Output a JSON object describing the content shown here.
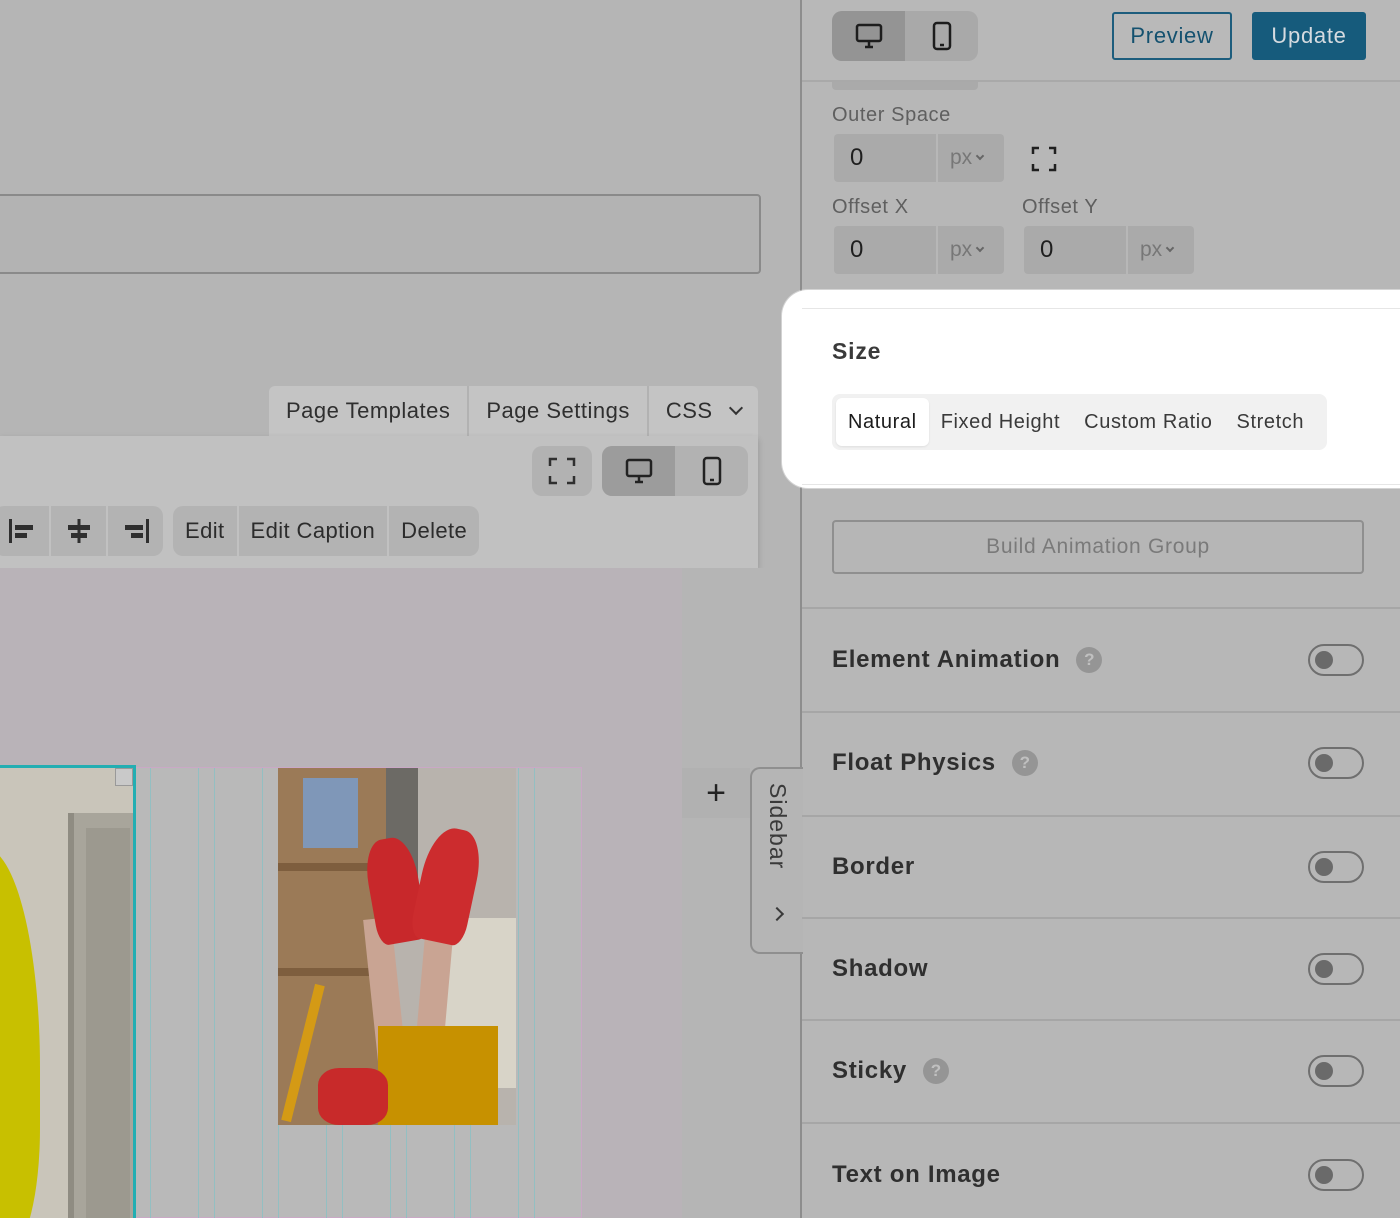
{
  "canvas": {
    "page_tabs": [
      {
        "label": "Page Templates"
      },
      {
        "label": "Page Settings"
      },
      {
        "label": "CSS"
      }
    ],
    "toolbar": {
      "fullscreen_icon": "fullscreen-icon",
      "devices": [
        {
          "icon": "desktop-icon",
          "active": true
        },
        {
          "icon": "mobile-icon",
          "active": false
        }
      ],
      "align_icons": [
        "align-left-icon",
        "align-center-icon",
        "align-right-icon"
      ],
      "actions": [
        {
          "label": "Edit"
        },
        {
          "label": "Edit Caption"
        },
        {
          "label": "Delete"
        }
      ]
    },
    "add_block_symbol": "+",
    "sidebar_handle_label": "Sidebar"
  },
  "panel": {
    "header": {
      "view_toggle": [
        {
          "icon": "desktop-icon",
          "active": true
        },
        {
          "icon": "mobile-icon",
          "active": false
        }
      ],
      "preview_label": "Preview",
      "update_label": "Update"
    },
    "outer_space": {
      "label": "Outer Space",
      "value": "0",
      "unit": "px",
      "link_icon": "expand-corners-icon"
    },
    "offset_x": {
      "label": "Offset X",
      "value": "0",
      "unit": "px"
    },
    "offset_y": {
      "label": "Offset Y",
      "value": "0",
      "unit": "px"
    },
    "size": {
      "title": "Size",
      "options": [
        {
          "label": "Natural",
          "active": true
        },
        {
          "label": "Fixed Height",
          "active": false
        },
        {
          "label": "Custom Ratio",
          "active": false
        },
        {
          "label": "Stretch",
          "active": false
        }
      ]
    },
    "build_animation_label": "Build Animation Group",
    "toggles": [
      {
        "label": "Element Animation",
        "help": true,
        "on": false
      },
      {
        "label": "Float Physics",
        "help": true,
        "on": false
      },
      {
        "label": "Border",
        "help": false,
        "on": false
      },
      {
        "label": "Shadow",
        "help": false,
        "on": false
      },
      {
        "label": "Sticky",
        "help": true,
        "on": false
      },
      {
        "label": "Text on Image",
        "help": false,
        "on": false
      }
    ],
    "help_symbol": "?"
  },
  "colors": {
    "accent": "#165b7c",
    "selection_outline": "#23aeb2",
    "highlight_card": "#ffffff",
    "dim_overlay": "#b5b5b5"
  }
}
